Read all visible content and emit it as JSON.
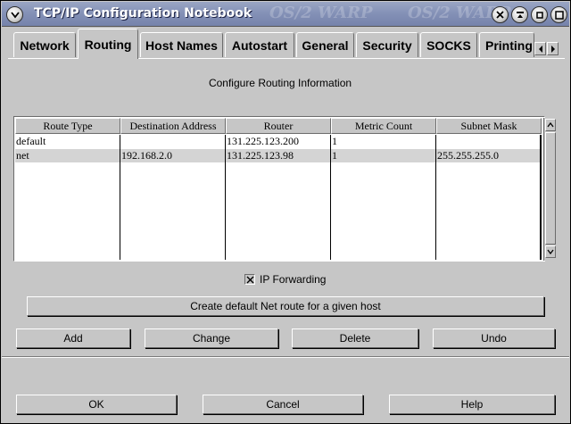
{
  "window": {
    "title": "TCP/IP Configuration Notebook",
    "watermark": "OS/2 WARP"
  },
  "tabs": [
    {
      "label": "Network",
      "active": false
    },
    {
      "label": "Routing",
      "active": true
    },
    {
      "label": "Host Names",
      "active": false
    },
    {
      "label": "Autostart",
      "active": false
    },
    {
      "label": "General",
      "active": false
    },
    {
      "label": "Security",
      "active": false
    },
    {
      "label": "SOCKS",
      "active": false
    },
    {
      "label": "Printing",
      "active": false
    }
  ],
  "page": {
    "heading": "Configure Routing Information"
  },
  "table": {
    "columns": [
      "Route Type",
      "Destination Address",
      "Router",
      "Metric Count",
      "Subnet Mask"
    ],
    "rows": [
      [
        "default",
        "",
        "131.225.123.200",
        "1",
        ""
      ],
      [
        "net",
        "192.168.2.0",
        "131.225.123.98",
        "1",
        "255.255.255.0"
      ]
    ]
  },
  "ip_forwarding": {
    "label": "IP Forwarding",
    "checked": true
  },
  "buttons": {
    "create_default": "Create default Net route for a given host",
    "add": "Add",
    "change": "Change",
    "delete": "Delete",
    "undo": "Undo",
    "ok": "OK",
    "cancel": "Cancel",
    "help": "Help"
  }
}
